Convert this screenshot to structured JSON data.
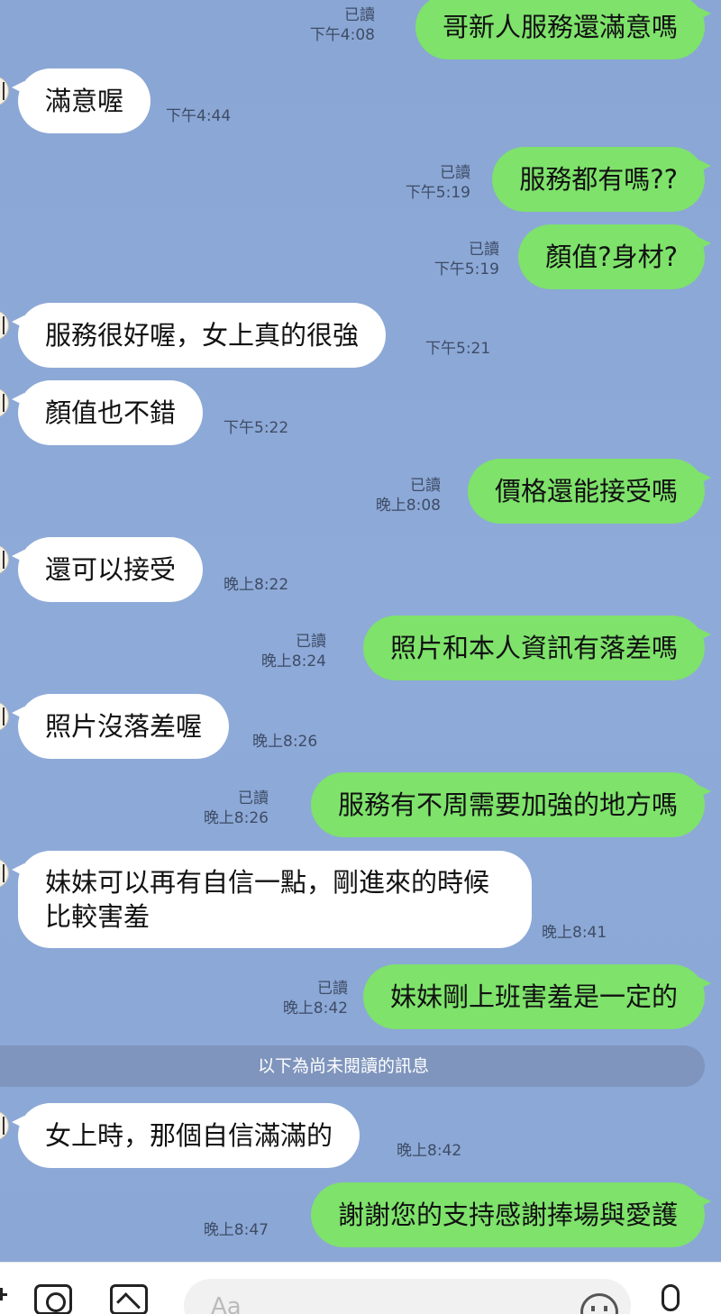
{
  "messages": [
    {
      "side": "out",
      "text": "哥新人服務還滿意嗎",
      "read": "已讀",
      "time": "下午4:08"
    },
    {
      "side": "in",
      "text": "滿意喔",
      "time": "下午4:44"
    },
    {
      "side": "out",
      "text": "服務都有嗎??",
      "read": "已讀",
      "time": "下午5:19"
    },
    {
      "side": "out",
      "text": "顏值?身材?",
      "read": "已讀",
      "time": "下午5:19"
    },
    {
      "side": "in",
      "text": "服務很好喔，女上真的很強",
      "time": "下午5:21"
    },
    {
      "side": "in",
      "text": "顏值也不錯",
      "time": "下午5:22"
    },
    {
      "side": "out",
      "text": "價格還能接受嗎",
      "read": "已讀",
      "time": "晚上8:08"
    },
    {
      "side": "in",
      "text": "還可以接受",
      "time": "晚上8:22"
    },
    {
      "side": "out",
      "text": "照片和本人資訊有落差嗎",
      "read": "已讀",
      "time": "晚上8:24"
    },
    {
      "side": "in",
      "text": "照片沒落差喔",
      "time": "晚上8:26"
    },
    {
      "side": "out",
      "text": "服務有不周需要加強的地方嗎",
      "read": "已讀",
      "time": "晚上8:26"
    },
    {
      "side": "in",
      "text": "妹妹可以再有自信一點，剛進來的時候比較害羞",
      "time": "晚上8:41"
    },
    {
      "side": "out",
      "text": "妹妹剛上班害羞是一定的",
      "read": "已讀",
      "time": "晚上8:42"
    },
    {
      "side": "in",
      "text": "女上時，那個自信滿滿的",
      "time": "晚上8:42"
    },
    {
      "side": "out",
      "text": "謝謝您的支持感謝捧場與愛護",
      "time": "晚上8:47"
    }
  ],
  "divider": "以下為尚未閱讀的訊息",
  "composer": {
    "placeholder": "Aa"
  },
  "colors": {
    "background": "#8ca8d6",
    "outgoing": "#7ee26b",
    "incoming": "#ffffff"
  }
}
